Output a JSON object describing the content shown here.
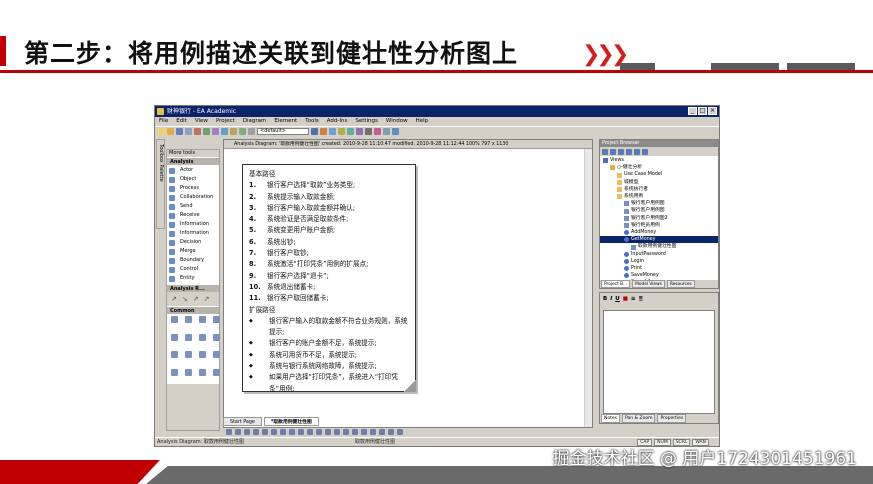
{
  "slide": {
    "title": "第二步：将用例描述关联到健壮性分析图上",
    "watermark": "掘金技术社区 @ 用户1724301451961",
    "colors": {
      "accent": "#c00000",
      "bar_gray": "#5a5a5a",
      "titlebar": "#0a246a"
    }
  },
  "app": {
    "title": "财神银行 - EA Academic",
    "menu": [
      "File",
      "Edit",
      "View",
      "Project",
      "Diagram",
      "Element",
      "Tools",
      "Add-Ins",
      "Settings",
      "Window",
      "Help"
    ],
    "toolbar_combo": "<default>",
    "toolbox": {
      "tab_label": "Toolbox Palette",
      "header": "More tools",
      "sections": [
        {
          "title": "Analysis",
          "items": [
            "Actor",
            "Object",
            "Process",
            "Collaboration",
            "Send",
            "Receive",
            "Information",
            "Information",
            "Decision",
            "Merge",
            "Boundary",
            "Control",
            "Entity"
          ]
        },
        {
          "title": "Analysis R...",
          "items": []
        },
        {
          "title": "Common",
          "items": []
        }
      ]
    },
    "diagram": {
      "tab_title": "Analysis Diagram: '取款用例健壮性图'  created: 2010-9-28 11:10:47  modified: 2010-9-28 11:12:44   100%   797 x 1130",
      "note": {
        "heading": "基本路径",
        "steps": [
          {
            "n": "1.",
            "text": "银行客户选择“取款”业务类型;"
          },
          {
            "n": "2.",
            "text": "系统提示输入取款金额;"
          },
          {
            "n": "3.",
            "text": "银行客户输入取款金额并确认;"
          },
          {
            "n": "4.",
            "text": "系统验证是否满足取款条件;"
          },
          {
            "n": "5.",
            "text": "系统变更用户账户金额;"
          },
          {
            "n": "6.",
            "text": "系统出钞;"
          },
          {
            "n": "7.",
            "text": "银行客户取钞;"
          },
          {
            "n": "8.",
            "text": "系统激活“打印凭条”用例的扩展点;"
          },
          {
            "n": "9.",
            "text": "银行客户选择“退卡”;"
          },
          {
            "n": "10.",
            "text": "系统退出储蓄卡;"
          },
          {
            "n": "11.",
            "text": "银行客户取回储蓄卡;"
          }
        ],
        "ext_heading": "扩展路径",
        "extensions": [
          "银行客户输入的取款金额不符合业务规则，系统提示;",
          "银行客户的账户金额不足，系统提示;",
          "系统可用货币不足，系统提示;",
          "系统与银行系统网络故障，系统提示;",
          "如果用户选择“打印凭条”，系统进入“打印凭条”用例;"
        ],
        "bullet": "◆"
      },
      "bottom_tabs": [
        "Start Page",
        "*取款用例健壮性图"
      ]
    },
    "project_browser": {
      "title": "Project Browser",
      "tree": [
        {
          "indent": 0,
          "label": "Views",
          "icon": "root"
        },
        {
          "indent": 1,
          "label": "○-健壮分析",
          "icon": "package"
        },
        {
          "indent": 2,
          "label": "Use Case Model",
          "icon": "folder"
        },
        {
          "indent": 2,
          "label": "城模型",
          "icon": "folder"
        },
        {
          "indent": 2,
          "label": "系统执行者",
          "icon": "folder"
        },
        {
          "indent": 2,
          "label": "系统用例",
          "icon": "folder"
        },
        {
          "indent": 3,
          "label": "银行客户用例图",
          "icon": "diagram"
        },
        {
          "indent": 3,
          "label": "银行客户用例图",
          "icon": "diagram"
        },
        {
          "indent": 3,
          "label": "银行客户用例图2",
          "icon": "diagram"
        },
        {
          "indent": 3,
          "label": "银行柜员用例",
          "icon": "diagram"
        },
        {
          "indent": 3,
          "label": "AddMoney",
          "icon": "usecase"
        },
        {
          "indent": 3,
          "label": "GetMoney",
          "icon": "usecase",
          "selected": true
        },
        {
          "indent": 4,
          "label": "取款用例健壮性图",
          "icon": "diagram"
        },
        {
          "indent": 3,
          "label": "InputPassword",
          "icon": "usecase"
        },
        {
          "indent": 3,
          "label": "Login",
          "icon": "usecase"
        },
        {
          "indent": 3,
          "label": "Print",
          "icon": "usecase"
        },
        {
          "indent": 3,
          "label": "SaveMoney",
          "icon": "usecase"
        },
        {
          "indent": 3,
          "label": "SearchAcc",
          "icon": "usecase"
        }
      ],
      "tabs": [
        "Project B...",
        "Model Views",
        "Resources"
      ]
    },
    "notes": {
      "format_buttons": [
        "B",
        "I",
        "U"
      ],
      "tabs": [
        "Notes",
        "Pan & Zoom",
        "Properties"
      ]
    },
    "status": {
      "left": "Analysis Diagram: 取款用例健壮性图",
      "middle": "取款用例健壮性图",
      "right": [
        "CAP",
        "NUM",
        "SCRL",
        "WAN"
      ]
    }
  }
}
